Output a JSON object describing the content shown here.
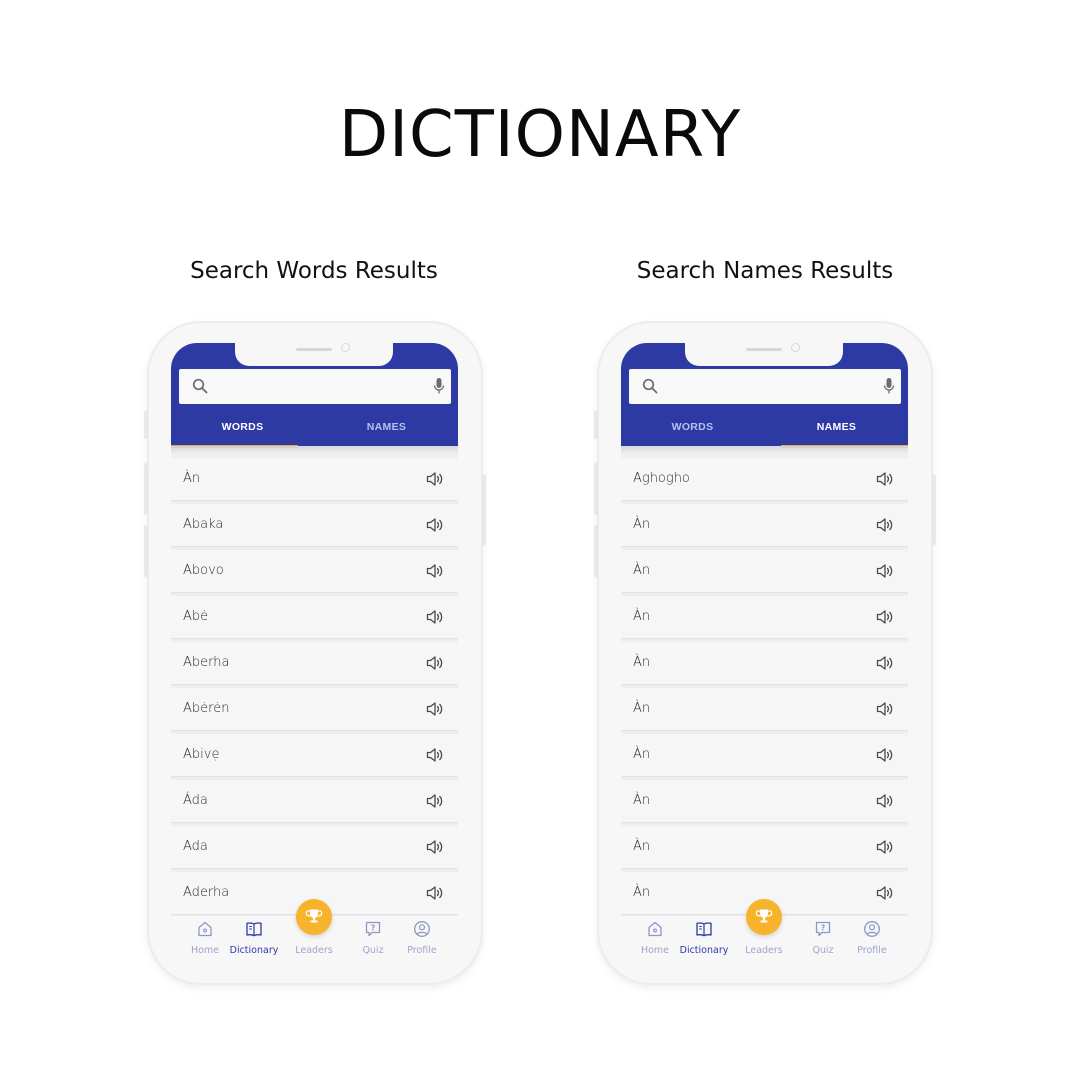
{
  "page": {
    "title": "DICTIONARY"
  },
  "screens": [
    {
      "caption": "Search Words Results",
      "search": {
        "placeholder": "",
        "value": ""
      },
      "tabs": [
        {
          "label": "WORDS",
          "active": true
        },
        {
          "label": "NAMES",
          "active": false
        }
      ],
      "items": [
        "Àn",
        "Abaka",
        "Abovo",
        "Abė",
        "Aberha",
        "Abėrėn",
        "Abivẹ",
        "Áda",
        "Ada",
        "Aderha"
      ],
      "nav": {
        "home": "Home",
        "dictionary": "Dictionary",
        "leaders": "Leaders",
        "quiz": "Quiz",
        "profile": "Profile",
        "active": "dictionary"
      }
    },
    {
      "caption": "Search Names Results",
      "search": {
        "placeholder": "",
        "value": ""
      },
      "tabs": [
        {
          "label": "WORDS",
          "active": false
        },
        {
          "label": "NAMES",
          "active": true
        }
      ],
      "items": [
        "Aghogho",
        "Àn",
        "Àn",
        "Àn",
        "Àn",
        "Àn",
        "Àn",
        "Àn",
        "Àn",
        "Àn"
      ],
      "nav": {
        "home": "Home",
        "dictionary": "Dictionary",
        "leaders": "Leaders",
        "quiz": "Quiz",
        "profile": "Profile",
        "active": "dictionary"
      }
    }
  ],
  "colors": {
    "header": "#2d3aa4",
    "tab_indicator": "#d9a954",
    "leaders_button": "#f7b32b",
    "nav_inactive": "#9ea5c9"
  },
  "icons": {
    "search": "search-icon",
    "mic": "microphone-icon",
    "pronounce": "speaker-icon",
    "home": "home-icon",
    "dictionary": "book-icon",
    "leaders": "trophy-icon",
    "quiz": "question-bubble-icon",
    "profile": "user-circle-icon"
  }
}
